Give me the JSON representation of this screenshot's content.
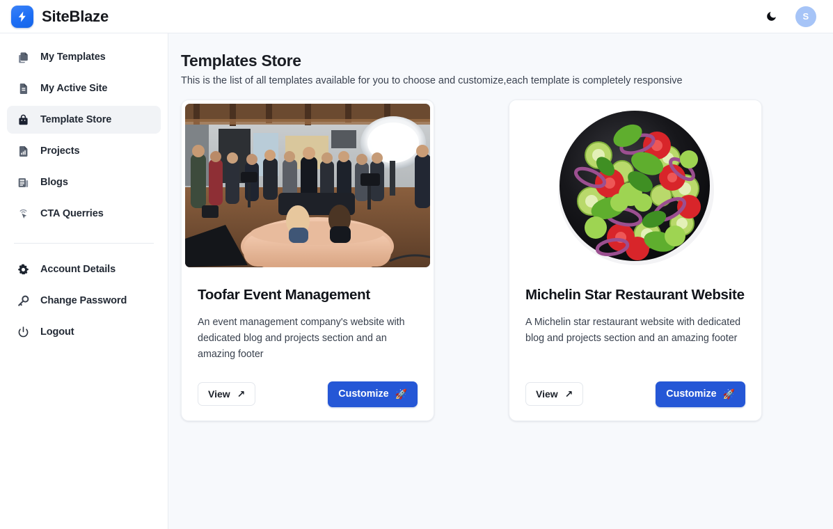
{
  "brand": {
    "name": "SiteBlaze",
    "logo_icon": "lightning-bolt-icon",
    "logo_color": "#1d6ef5"
  },
  "topbar": {
    "theme_toggle_icon": "moon-icon",
    "avatar_initial": "S",
    "avatar_color": "#a6c4f7"
  },
  "sidebar": {
    "items": [
      {
        "label": "My Templates",
        "icon": "copy-stack-icon",
        "active": false
      },
      {
        "label": "My Active Site",
        "icon": "file-icon",
        "active": false
      },
      {
        "label": "Template Store",
        "icon": "shopping-bag-icon",
        "active": true
      },
      {
        "label": "Projects",
        "icon": "bar-chart-file-icon",
        "active": false
      },
      {
        "label": "Blogs",
        "icon": "newspaper-icon",
        "active": false
      },
      {
        "label": "CTA Querries",
        "icon": "cursor-click-icon",
        "active": false
      }
    ],
    "footer_items": [
      {
        "label": "Account Details",
        "icon": "gear-icon"
      },
      {
        "label": "Change Password",
        "icon": "key-icon"
      },
      {
        "label": "Logout",
        "icon": "power-icon"
      }
    ]
  },
  "main": {
    "title": "Templates Store",
    "subtitle": "This is the list of all templates available for you to choose and customize,each template is completely responsive",
    "cards": [
      {
        "title": "Toofar Event Management",
        "description": "An event management company's website with dedicated blog and projects section and an amazing footer",
        "image_alt": "event-studio-photo",
        "view_label": "View",
        "view_icon": "arrow-up-right-icon",
        "customize_label": "Customize",
        "customize_icon": "rocket-icon"
      },
      {
        "title": "Michelin Star Restaurant Website",
        "description": "A Michelin star restaurant website with dedicated blog and projects section and an amazing footer",
        "image_alt": "salad-bowl-photo",
        "view_label": "View",
        "view_icon": "arrow-up-right-icon",
        "customize_label": "Customize",
        "customize_icon": "rocket-icon"
      }
    ]
  },
  "colors": {
    "accent": "#2557d6",
    "page_bg": "#f7f9fc",
    "panel_bg": "#ffffff",
    "text": "#1a1d23"
  }
}
